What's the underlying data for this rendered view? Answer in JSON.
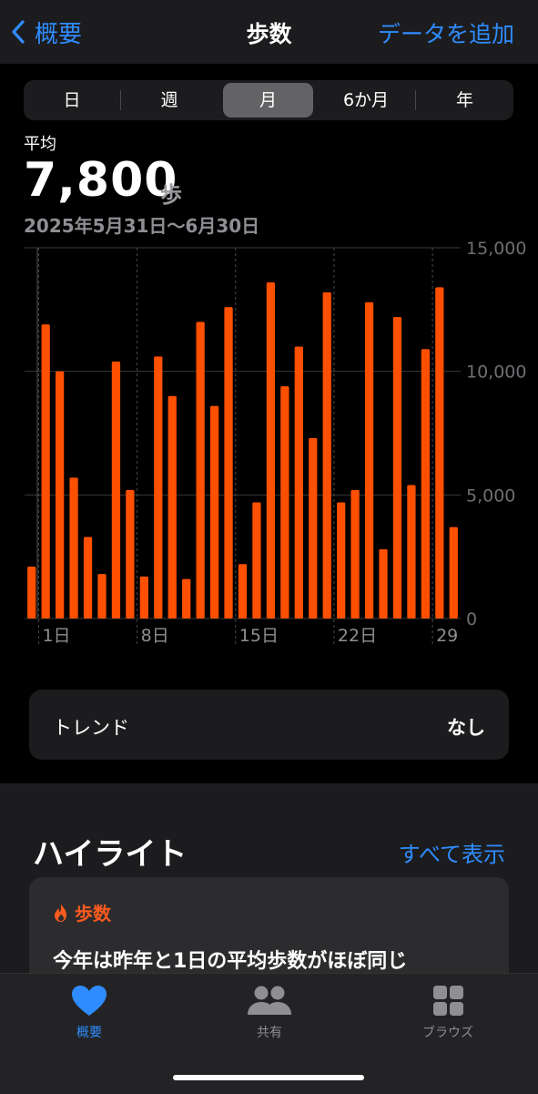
{
  "nav": {
    "back_label": "概要",
    "title": "歩数",
    "add_label": "データを追加"
  },
  "segments": [
    "日",
    "週",
    "月",
    "6か月",
    "年"
  ],
  "selected_segment": "月",
  "summary": {
    "label": "平均",
    "value": "7,800",
    "unit": "歩",
    "date_range": "2025年5月31日〜6月30日"
  },
  "chart_data": {
    "type": "bar",
    "x": [
      "5/31",
      "6/1",
      "6/2",
      "6/3",
      "6/4",
      "6/5",
      "6/6",
      "6/7",
      "6/8",
      "6/9",
      "6/10",
      "6/11",
      "6/12",
      "6/13",
      "6/14",
      "6/15",
      "6/16",
      "6/17",
      "6/18",
      "6/19",
      "6/20",
      "6/21",
      "6/22",
      "6/23",
      "6/24",
      "6/25",
      "6/26",
      "6/27",
      "6/28",
      "6/29",
      "6/30"
    ],
    "values": [
      2100,
      11900,
      10000,
      5700,
      3300,
      1800,
      10400,
      5200,
      1700,
      10600,
      9000,
      1600,
      12000,
      8600,
      12600,
      2200,
      4700,
      13600,
      9400,
      11000,
      7300,
      13200,
      4700,
      5200,
      12800,
      2800,
      12200,
      5400,
      10900,
      13400,
      3700
    ],
    "x_tick_labels": [
      "1日",
      "8日",
      "15日",
      "22日",
      "29"
    ],
    "y_ticks": [
      "0",
      "5,000",
      "10,000",
      "15,000"
    ],
    "ylim": [
      0,
      15000
    ],
    "bar_color": "#ff4f00",
    "grid": true
  },
  "trend": {
    "label": "トレンド",
    "value": "なし"
  },
  "highlights": {
    "title": "ハイライト",
    "show_all": "すべて表示",
    "card": {
      "category": "歩数",
      "text": "今年は昨年と1日の平均歩数がほぼ同じ"
    }
  },
  "tabs": [
    {
      "label": "概要",
      "icon": "heart-icon",
      "active": true
    },
    {
      "label": "共有",
      "icon": "people-icon",
      "active": false
    },
    {
      "label": "ブラウズ",
      "icon": "grid-icon",
      "active": false
    }
  ],
  "colors": {
    "accent": "#2f8cff",
    "orange": "#ff4f00"
  }
}
